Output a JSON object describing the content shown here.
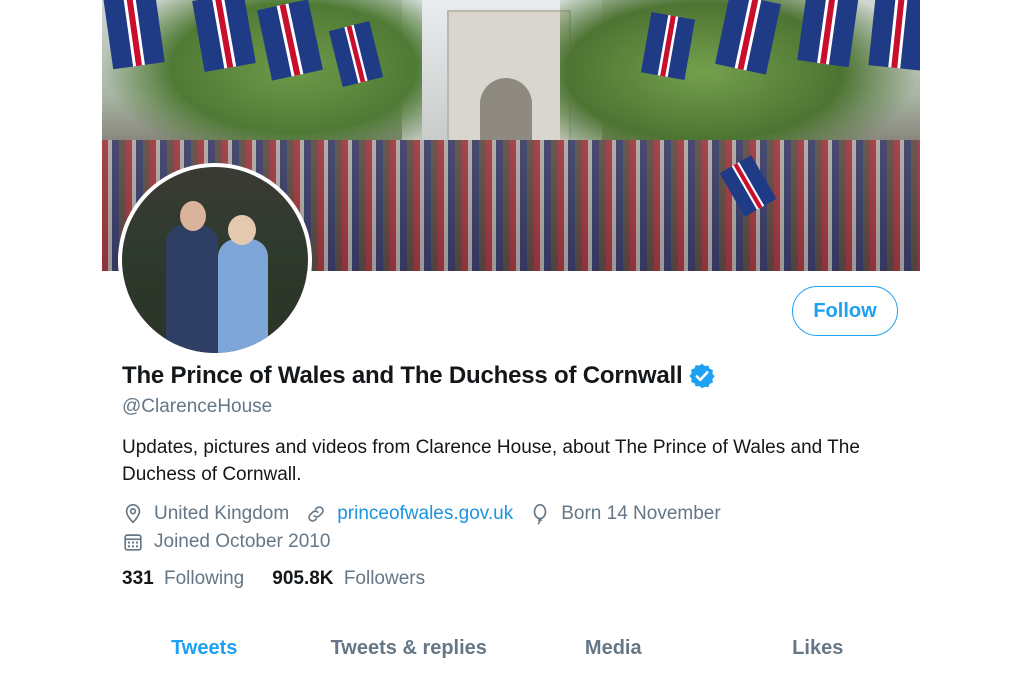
{
  "profile": {
    "display_name": "The Prince of Wales and The Duchess of Cornwall",
    "handle": "@ClarenceHouse",
    "verified": true,
    "bio": "Updates, pictures and videos from Clarence House, about The Prince of Wales and The Duchess of Cornwall.",
    "location": "United Kingdom",
    "website": "princeofwales.gov.uk",
    "birthday": "Born 14 November",
    "joined": "Joined October 2010"
  },
  "actions": {
    "follow_label": "Follow"
  },
  "counts": {
    "following_value": "331",
    "following_label": "Following",
    "followers_value": "905.8K",
    "followers_label": "Followers"
  },
  "tabs": [
    {
      "label": "Tweets",
      "active": true
    },
    {
      "label": "Tweets & replies",
      "active": false
    },
    {
      "label": "Media",
      "active": false
    },
    {
      "label": "Likes",
      "active": false
    }
  ],
  "icons": {
    "verified": "verified-badge-icon",
    "location": "location-pin-icon",
    "website": "link-icon",
    "birthday": "balloon-icon",
    "joined": "calendar-icon"
  },
  "colors": {
    "accent": "#1da1f2",
    "muted": "#657786",
    "text": "#14171a",
    "link": "#1b95e0"
  }
}
